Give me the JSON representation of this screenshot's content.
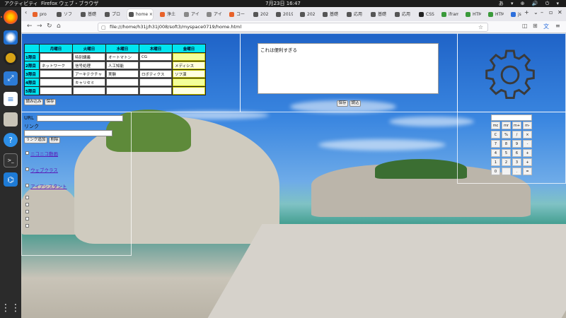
{
  "topbar": {
    "activities": "アクティビティ",
    "app": "Firefox ウェブ・ブラウザ",
    "clock": "7月23日 16:47",
    "tray": "あ ▾ ⊕ 🔊 ⏻ ▾"
  },
  "dock": {
    "items": [
      "firefox-icon",
      "thunderbird-icon",
      "rhythmbox-icon",
      "software-center-icon",
      "writer-icon",
      "files-icon",
      "help-icon",
      "terminal-icon",
      "vscode-icon",
      "app-grid-icon"
    ]
  },
  "tabs": [
    {
      "label": "pro",
      "color": "#e8622a"
    },
    {
      "label": "ソフ",
      "color": "#555"
    },
    {
      "label": "基礎",
      "color": "#555"
    },
    {
      "label": "プロ",
      "color": "#555"
    },
    {
      "label": "home",
      "color": "#555"
    },
    {
      "label": "浄土",
      "color": "#e8622a"
    },
    {
      "label": "アイア",
      "color": "#888"
    },
    {
      "label": "アイ",
      "color": "#888"
    },
    {
      "label": "コー",
      "color": "#e8622a"
    },
    {
      "label": "202",
      "color": "#555"
    },
    {
      "label": "2019",
      "color": "#555"
    },
    {
      "label": "202",
      "color": "#555"
    },
    {
      "label": "基礎",
      "color": "#555"
    },
    {
      "label": "応用",
      "color": "#555"
    },
    {
      "label": "基礎",
      "color": "#555"
    },
    {
      "label": "応用",
      "color": "#555"
    },
    {
      "label": "CSS",
      "color": "#222"
    },
    {
      "label": "ifram",
      "color": "#3a9a3a"
    },
    {
      "label": "HTM",
      "color": "#3a9a3a"
    },
    {
      "label": "HTM",
      "color": "#3a9a3a"
    },
    {
      "label": "js",
      "color": "#2c6fdc"
    }
  ],
  "tab_controls": {
    "new_tab": "+",
    "list": "⌄",
    "minimize": "–",
    "restore": "▫",
    "close": "✕"
  },
  "nav": {
    "back": "←",
    "forward": "→",
    "reload": "↻",
    "home": "⌂",
    "url": "file:///home/h31j/h31j008/soft3/myspace0719/home.html"
  },
  "timetable": {
    "days": [
      "月曜日",
      "火曜日",
      "水曜日",
      "木曜日",
      "金曜日"
    ],
    "periods": [
      "1限目",
      "2限目",
      "3限目",
      "4限目",
      "5限目"
    ],
    "cells": [
      [
        "",
        "特別講義",
        "オートマトン",
        "CG",
        ""
      ],
      [
        "ネットワーク",
        "信号処理",
        "人工知能",
        "",
        "メディシス"
      ],
      [
        "",
        "アーキテクチャ",
        "実験",
        "ロボティクス",
        "ソフ演"
      ],
      [
        "",
        "キャリセミ",
        "",
        "",
        ""
      ],
      [
        "",
        "",
        "",
        "",
        ""
      ]
    ],
    "load_button": "読み込み",
    "save_button": "保存"
  },
  "memo": {
    "text": "これは便利すぎる",
    "save_button": "保存",
    "load_button": "読込"
  },
  "links_panel": {
    "url_label": "URL",
    "link_label": "リンク",
    "add_button": "リンク追加",
    "delete_button": "削除",
    "links": [
      "ニコニコ動画",
      "ウェブクラス",
      "アイアシスタント"
    ]
  },
  "calculator": {
    "keys": [
      "mc",
      "mr",
      "m+",
      "m-",
      "C",
      "%",
      "/",
      "×",
      "7",
      "8",
      "9",
      "-",
      "4",
      "5",
      "6",
      "+",
      "1",
      "2",
      "3",
      "+",
      "0",
      "",
      ".",
      "="
    ]
  },
  "colors": {
    "header_cyan": "#00e5f0",
    "friday_highlight": "#f4ff9a",
    "link_purple": "#5a1ab8"
  }
}
